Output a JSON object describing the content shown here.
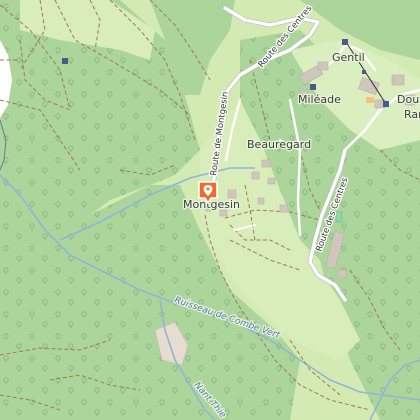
{
  "map": {
    "places": {
      "gentil": "Gentil",
      "mileade": "Miléade",
      "dou": "Dou",
      "ran": "Ran",
      "beauregard": "Beauregard",
      "montgesin": "Montgesin"
    },
    "roads": {
      "route_des_centres_top": "Route des Centres",
      "route_de_montgesin": "Route de Montgesin",
      "route_des_centres_bottom": "Route des Centres"
    },
    "waterways": {
      "ruisseau": "Ruisseau de Combe Vert",
      "nant": "Nant Thie"
    },
    "marker": {
      "icon": "location-pin-icon",
      "color": "#f06a2a"
    },
    "colors": {
      "forest": "#a9d39a",
      "meadow": "#d6ebb6",
      "road": "#ffffff",
      "track": "#9a7a4a",
      "stream": "#8fb6d6",
      "building": "#cfc7bd"
    }
  }
}
